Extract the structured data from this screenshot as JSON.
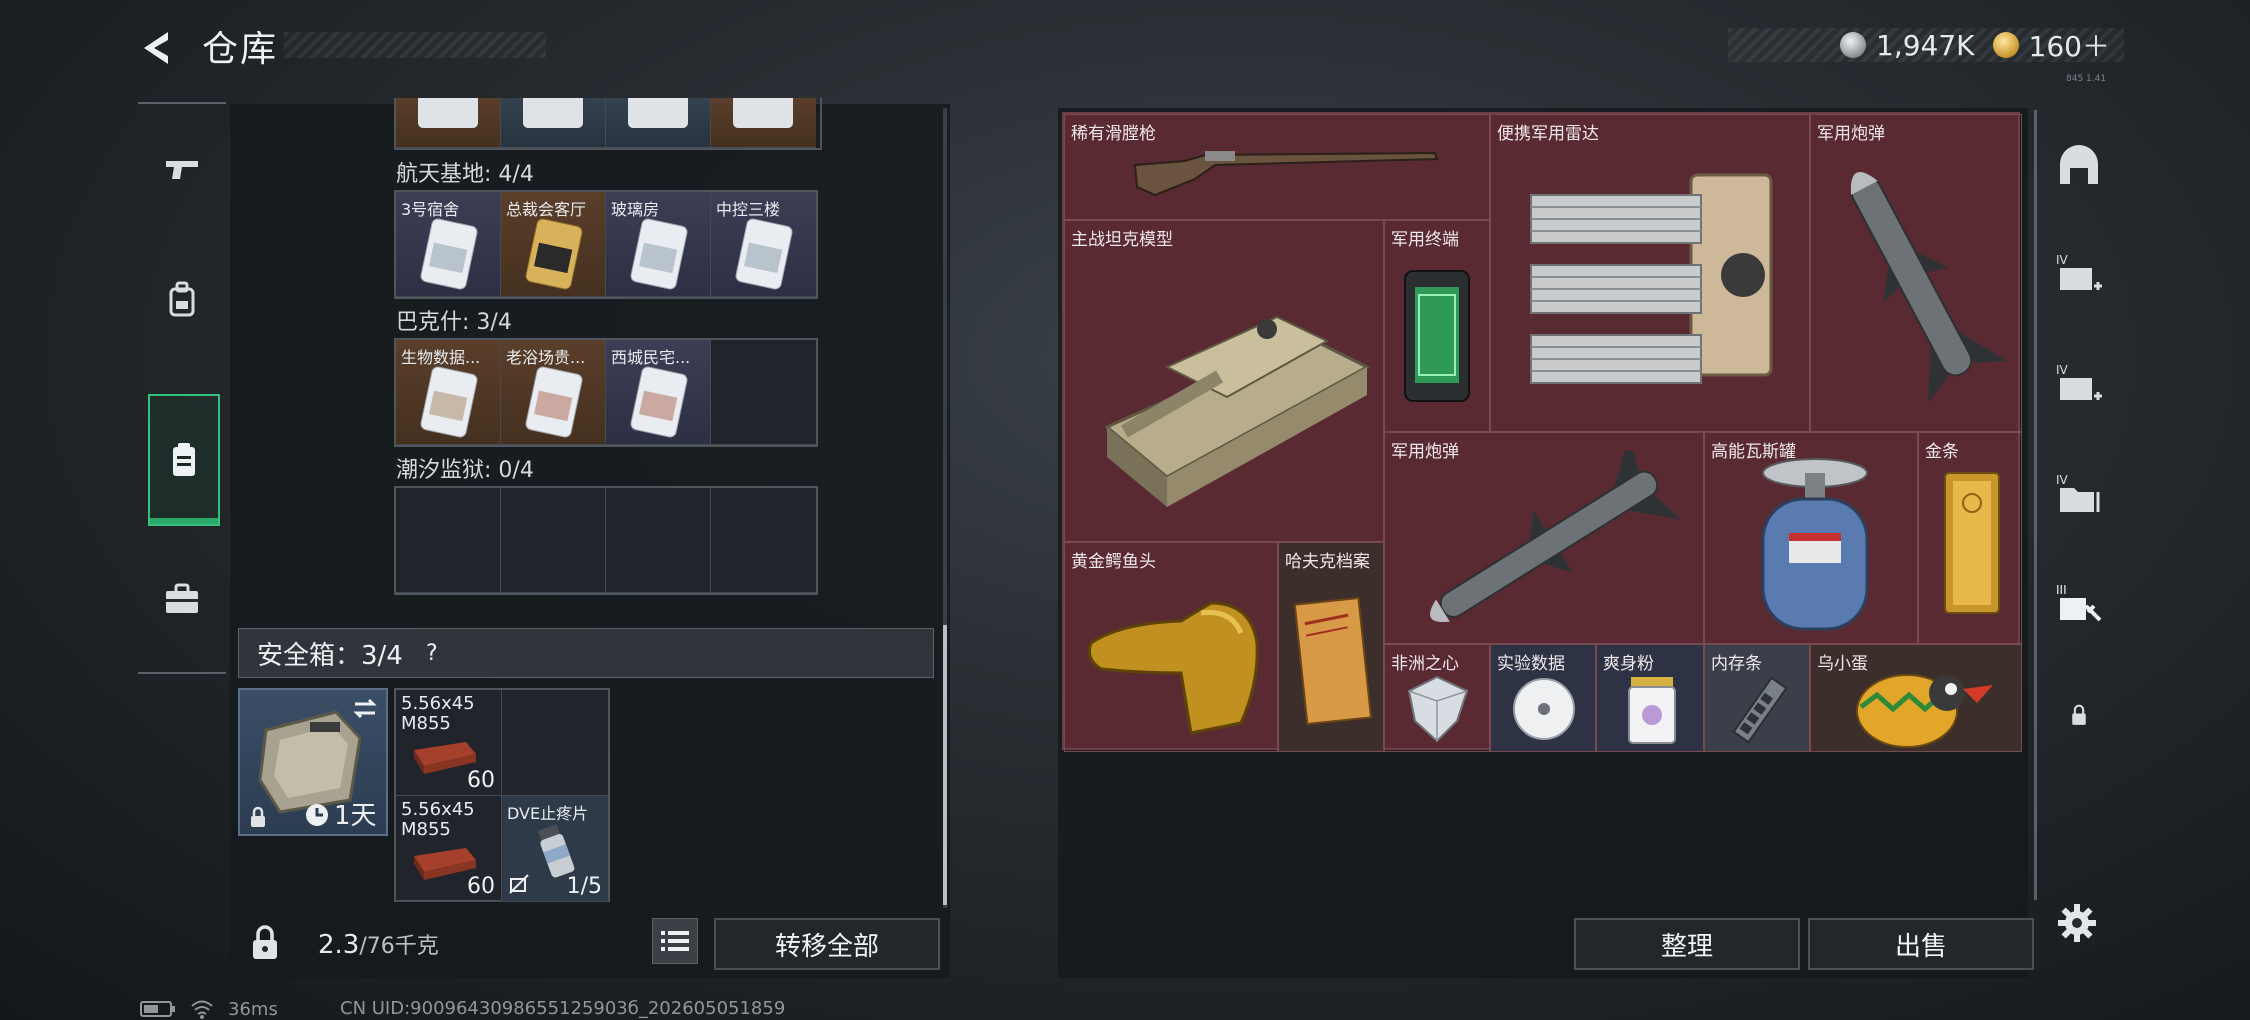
{
  "header": {
    "title": "仓库",
    "silver_amount": "1,947K",
    "gold_amount": "160＋",
    "version": "845 1.41"
  },
  "left_tabs": [
    {
      "name": "weapons"
    },
    {
      "name": "equipment"
    },
    {
      "name": "storage",
      "active": true
    },
    {
      "name": "case"
    }
  ],
  "card_sections": [
    {
      "label": "航天基地: 4/4",
      "cards": [
        "3号宿舍",
        "总裁会客厅",
        "玻璃房",
        "中控三楼"
      ]
    },
    {
      "label": "巴克什: 3/4",
      "cards": [
        "生物数据...",
        "老浴场贵...",
        "西城民宅..."
      ]
    },
    {
      "label": "潮汐监狱: 0/4",
      "cards": []
    }
  ],
  "safe_box": {
    "label": "安全箱：3/4",
    "help": "?",
    "case_timer": "1天",
    "items": [
      {
        "name": "5.56x45 M855",
        "count": "60"
      },
      {
        "name": "5.56x45 M855",
        "count": "60"
      },
      {
        "name": "DVE止疼片",
        "count": "1/5"
      }
    ]
  },
  "footer_left": {
    "weight_current": "2.3",
    "weight_unit": "/76千克",
    "transfer_all": "转移全部"
  },
  "storage_items": [
    {
      "name": "稀有滑膛枪"
    },
    {
      "name": "便携军用雷达"
    },
    {
      "name": "军用炮弹"
    },
    {
      "name": "主战坦克模型"
    },
    {
      "name": "军用终端"
    },
    {
      "name": "军用炮弹"
    },
    {
      "name": "高能瓦斯罐"
    },
    {
      "name": "金条"
    },
    {
      "name": "黄金鳄鱼头"
    },
    {
      "name": "哈夫克档案"
    },
    {
      "name": "非洲之心"
    },
    {
      "name": "实验数据"
    },
    {
      "name": "爽身粉"
    },
    {
      "name": "内存条"
    },
    {
      "name": "乌小蛋"
    }
  ],
  "footer_right": {
    "sort": "整理",
    "sell": "出售"
  },
  "status_bar": {
    "ping": "36ms",
    "uid": "CN UID:9009643098655125903б_202605051859"
  },
  "colors": {
    "accent_green": "#34c27a",
    "storage_bg": "#5a2a32",
    "panel_bg": "#161a1e"
  }
}
